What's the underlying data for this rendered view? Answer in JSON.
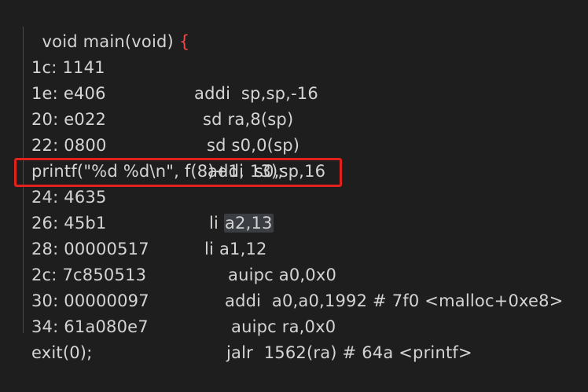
{
  "header": {
    "signature": "void main(void) ",
    "open_brace": "{"
  },
  "lines": [
    {
      "addr": "1c: 1141",
      "instr": "addi  sp,sp,-16"
    },
    {
      "addr": "1e: e406",
      "instr": "sd ra,8(sp)"
    },
    {
      "addr": "20: e022",
      "instr": "sd s0,0(sp)"
    },
    {
      "addr": "22: 0800",
      "instr": "addi  s0,sp,16"
    },
    {
      "source": "printf(\"%d %d\\n\", f(8)+1, 13);"
    },
    {
      "addr": "24: 4635",
      "instr_prefix": "li ",
      "instr_selected": "a2,13"
    },
    {
      "addr": "26: 45b1",
      "instr": "li a1,12"
    },
    {
      "addr": "28: 00000517",
      "instr": "auipc a0,0x0"
    },
    {
      "addr": "2c: 7c850513",
      "instr": "addi  a0,a0,1992 # 7f0 <malloc+0xe8>"
    },
    {
      "addr": "30: 00000097",
      "instr": "auipc ra,0x0"
    },
    {
      "addr": "34: 61a080e7",
      "instr": "jalr  1562(ra) # 64a <printf>"
    },
    {
      "source": "exit(0);"
    }
  ],
  "colors": {
    "background": "#1e1e1e",
    "text": "#d4d4d4",
    "brace": "#f44747",
    "highlight_box": "#e0211c",
    "selection": "#3a3d41"
  }
}
